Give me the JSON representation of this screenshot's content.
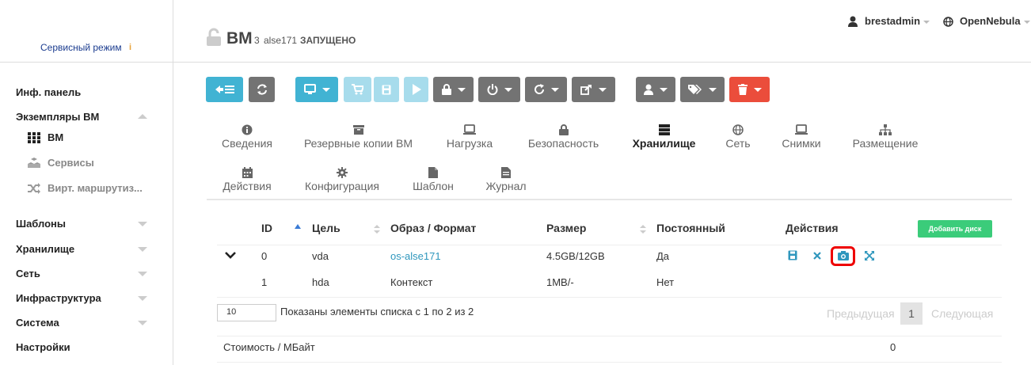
{
  "sidebar": {
    "mode_label": "Сервисный режим",
    "mode_info": "i",
    "items": [
      {
        "label": "Инф. панель"
      },
      {
        "label": "Экземпляры ВМ"
      },
      {
        "label": "Шаблоны"
      },
      {
        "label": "Хранилище"
      },
      {
        "label": "Сеть"
      },
      {
        "label": "Инфраструктура"
      },
      {
        "label": "Система"
      },
      {
        "label": "Настройки"
      }
    ],
    "sub_items": [
      {
        "label": "ВМ"
      },
      {
        "label": "Сервисы"
      },
      {
        "label": "Вирт. маршрутиз..."
      }
    ]
  },
  "header": {
    "title": "ВМ",
    "vm_id": "3",
    "vm_name": "alse171",
    "state": "ЗАПУЩЕНО",
    "user": "brestadmin",
    "zone": "OpenNebula"
  },
  "tabs": [
    {
      "label": "Сведения"
    },
    {
      "label": "Резервные копии ВМ"
    },
    {
      "label": "Нагрузка"
    },
    {
      "label": "Безопасность"
    },
    {
      "label": "Хранилище"
    },
    {
      "label": "Сеть"
    },
    {
      "label": "Снимки"
    },
    {
      "label": "Размещение"
    },
    {
      "label": "Действия"
    },
    {
      "label": "Конфигурация"
    },
    {
      "label": "Шаблон"
    },
    {
      "label": "Журнал"
    }
  ],
  "table": {
    "headers": [
      "ID",
      "Цель",
      "Образ / Формат",
      "Размер",
      "Постоянный",
      "Действия"
    ],
    "add_disk_label": "Добавить диск",
    "rows": [
      {
        "id": "0",
        "target": "vda",
        "image": "os-alse171",
        "size": "4.5GB/12GB",
        "persistent": "Да"
      },
      {
        "id": "1",
        "target": "hda",
        "image": "Контекст",
        "size": "1MB/-",
        "persistent": "Нет"
      }
    ]
  },
  "pagination": {
    "page_length": "10",
    "info_prefix": "Показаны элементы списка с ",
    "info_from": "1",
    "info_mid1": " по ",
    "info_to": "2",
    "info_mid2": " из ",
    "info_total": "2",
    "prev": "Предыдущая",
    "current": "1",
    "next": "Следующая"
  },
  "cost": {
    "label": "Стоимость / МБайт",
    "value": "0"
  },
  "colors": {
    "accent": "#41b3d3",
    "danger": "#eb4d3b",
    "success": "#3bcc7a",
    "link": "#2f97bd"
  }
}
